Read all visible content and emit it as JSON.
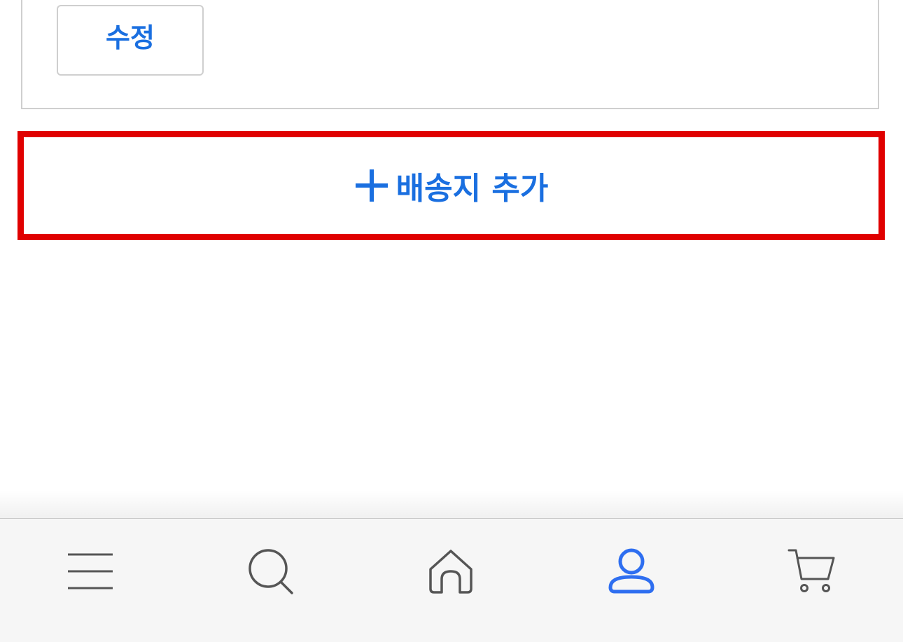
{
  "address_card": {
    "edit_label": "수정"
  },
  "add_address": {
    "label": "배송지 추가",
    "icon": "plus-icon"
  },
  "bottom_nav": {
    "items": [
      {
        "icon": "menu-icon",
        "active": false
      },
      {
        "icon": "search-icon",
        "active": false
      },
      {
        "icon": "home-icon",
        "active": false
      },
      {
        "icon": "user-icon",
        "active": true
      },
      {
        "icon": "cart-icon",
        "active": false
      }
    ]
  },
  "colors": {
    "accent": "#1a6fe0",
    "highlight_border": "#e00000",
    "icon_default": "#555555",
    "icon_active": "#2e6ef0",
    "nav_background": "#f6f6f6"
  }
}
